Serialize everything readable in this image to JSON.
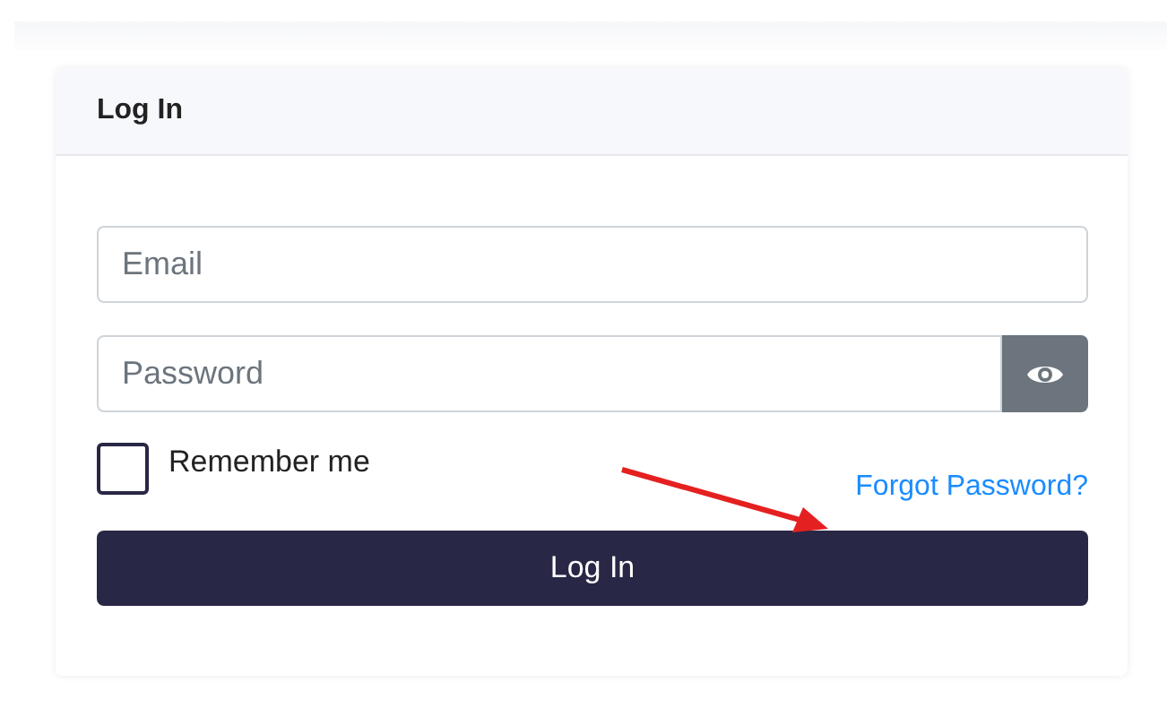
{
  "card": {
    "title": "Log In"
  },
  "email": {
    "placeholder": "Email"
  },
  "password": {
    "placeholder": "Password"
  },
  "remember": {
    "label": "Remember me",
    "checked": false
  },
  "forgot_link": "Forgot Password?",
  "submit": "Log In"
}
